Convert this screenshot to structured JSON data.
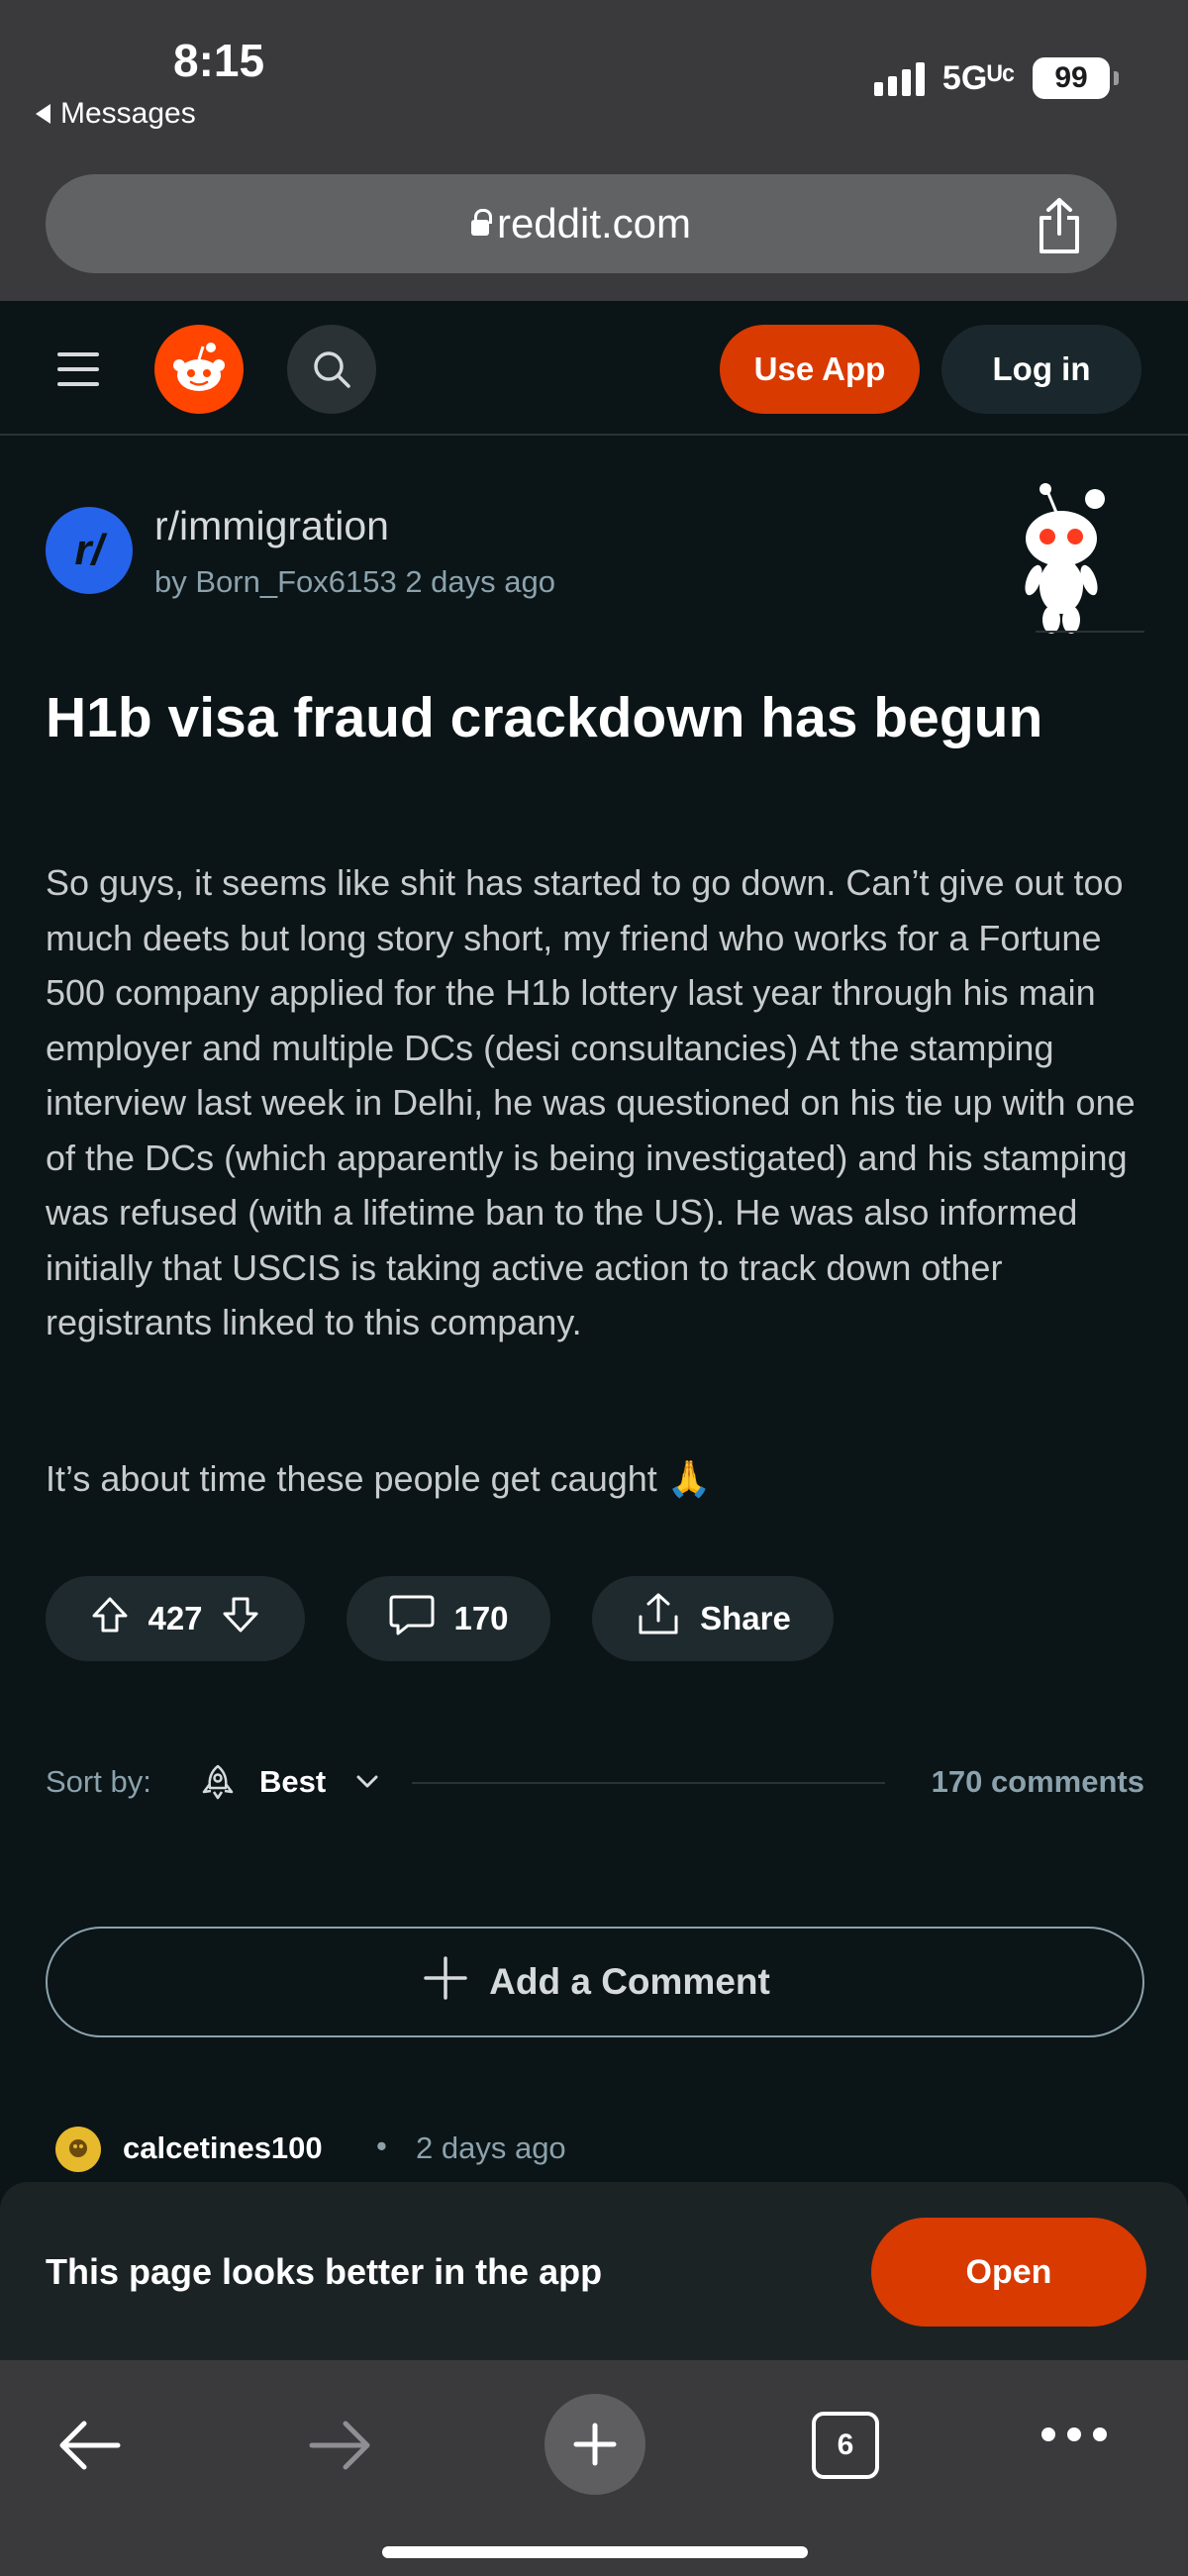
{
  "status_bar": {
    "time": "8:15",
    "back_app": "Messages",
    "network": "5Gᵁᶜ",
    "battery": "99"
  },
  "browser": {
    "url": "reddit.com",
    "tab_count": "6"
  },
  "header": {
    "use_app_label": "Use App",
    "login_label": "Log in",
    "accent_color": "#d93a00"
  },
  "post": {
    "subreddit_avatar_text": "r/",
    "subreddit": "r/immigration",
    "author_line": "by Born_Fox6153 2 days ago",
    "title": "H1b visa fraud crackdown has begun",
    "body": "So guys, it seems like shit has started to go down. Can’t give out too much deets but long story short, my friend who works for a Fortune 500 company applied for the H1b lottery last year through his main employer and multiple DCs (desi consultancies) At the stamping interview last week in Delhi, he was questioned on his tie up with one of the DCs (which apparently is being investigated) and his stamping was refused (with a lifetime ban to the US). He was also informed initially that USCIS is taking active action to track down other registrants linked to this company.",
    "body_2": "It’s about time these people get caught 🙏",
    "votes": "427",
    "comments": "170",
    "share_label": "Share"
  },
  "sort": {
    "label": "Sort by:",
    "value": "Best",
    "count": "170 comments"
  },
  "add_comment_label": "Add a Comment",
  "first_comment": {
    "author": "calcetines100",
    "dot": "•",
    "time": "2 days ago"
  },
  "banner": {
    "text": "This page looks better in the app",
    "open_label": "Open"
  }
}
